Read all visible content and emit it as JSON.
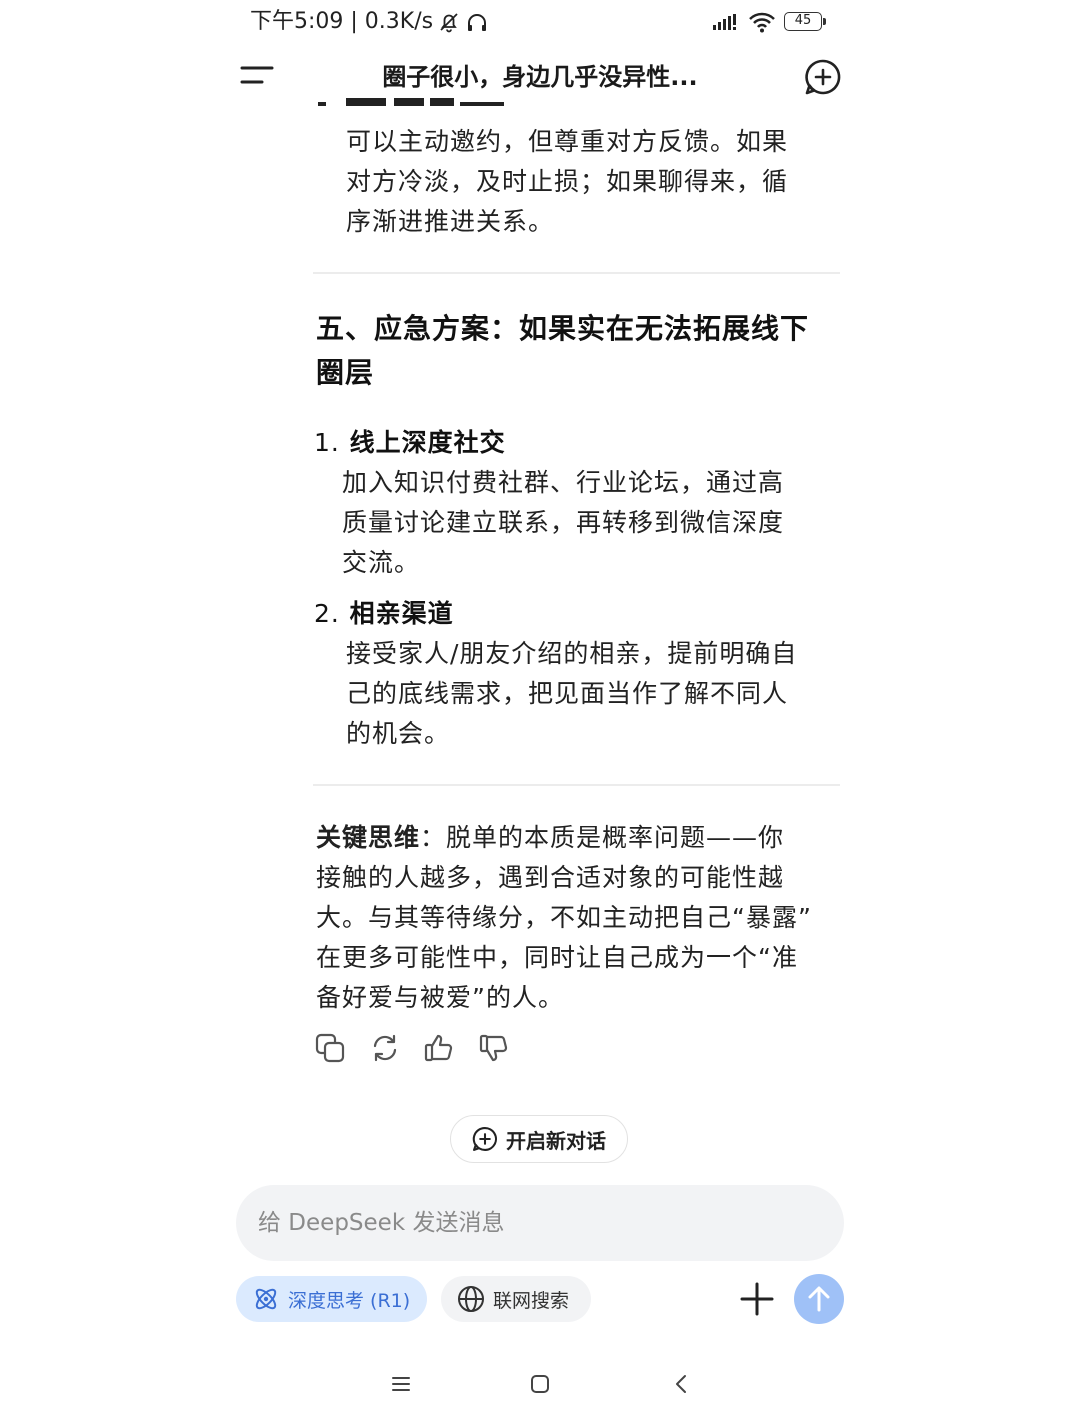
{
  "status_bar": {
    "time_speed": "下午5:09 | 0.3K/s",
    "battery": "45"
  },
  "header": {
    "title": "圈子很小，身边几乎没异性..."
  },
  "content": {
    "prev_item_desc": [
      "可以主动邀约，但尊重对方反馈。如果",
      "对方冷淡，及时止损；如果聊得来，循",
      "序渐进推进关系。"
    ],
    "section5_title": [
      "五、应急方案：如果实在无法拓展线下",
      "圈层"
    ],
    "list": [
      {
        "num": "1.",
        "title": "线上深度社交",
        "desc": [
          "加入知识付费社群、行业论坛，通过高",
          "质量讨论建立联系，再转移到微信深度",
          "交流。"
        ]
      },
      {
        "num": "2.",
        "title": "相亲渠道",
        "desc": [
          "接受家人/朋友介绍的相亲，提前明确自",
          "己的底线需求，把见面当作了解不同人",
          "的机会。"
        ]
      }
    ],
    "summary_label": "关键思维",
    "summary_colon": "：",
    "summary_lines": [
      "脱单的本质是概率问题——你",
      "接触的人越多，遇到合适对象的可能性越",
      "大。与其等待缘分，不如主动把自己“暴露”",
      "在更多可能性中，同时让自己成为一个“准",
      "备好爱与被爱”的人。"
    ]
  },
  "new_chat_pill": {
    "label": "开启新对话"
  },
  "composer": {
    "placeholder": "给 DeepSeek 发送消息",
    "deep_think_label": "深度思考 (R1)",
    "web_search_label": "联网搜索"
  },
  "icons": {
    "menu": "menu-icon",
    "new_chat": "plus-circle-icon",
    "copy": "copy-icon",
    "regenerate": "refresh-icon",
    "like": "thumbs-up-icon",
    "dislike": "thumbs-down-icon",
    "deep_think": "atom-icon",
    "web_search": "globe-icon",
    "attach": "plus-icon",
    "send": "arrow-up-icon"
  },
  "colors": {
    "accent_blue": "#3b6fd4",
    "chip_blue_bg": "#dbeafe",
    "send_button": "#9fc1f7"
  }
}
